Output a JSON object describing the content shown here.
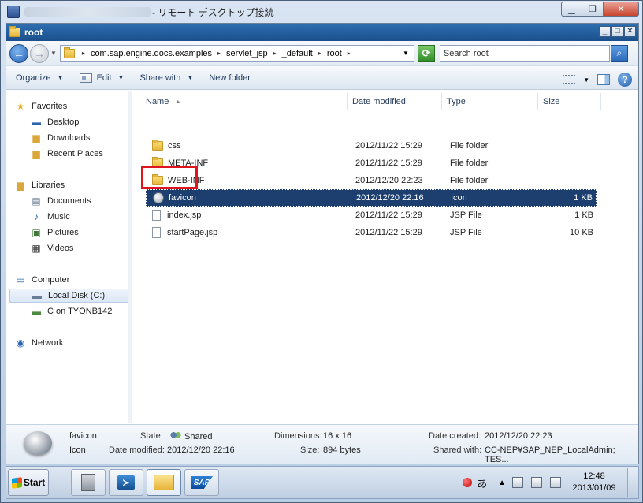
{
  "rdp": {
    "title": "- リモート デスクトップ接続"
  },
  "explorer": {
    "title": "root",
    "address": {
      "crumbs": [
        "com.sap.engine.docs.examples",
        "servlet_jsp",
        "_default",
        "root"
      ]
    },
    "search_placeholder": "Search root",
    "toolbar": {
      "organize": "Organize",
      "edit": "Edit",
      "share_with": "Share with",
      "new_folder": "New folder"
    },
    "nav": {
      "favorites": "Favorites",
      "desktop": "Desktop",
      "downloads": "Downloads",
      "recent": "Recent Places",
      "libraries": "Libraries",
      "documents": "Documents",
      "music": "Music",
      "pictures": "Pictures",
      "videos": "Videos",
      "computer": "Computer",
      "local_disk": "Local Disk (C:)",
      "c_on": "C on TYONB142",
      "network": "Network"
    },
    "columns": {
      "name": "Name",
      "date": "Date modified",
      "type": "Type",
      "size": "Size"
    },
    "files": [
      {
        "name": "css",
        "date": "2012/11/22 15:29",
        "type": "File folder",
        "size": ""
      },
      {
        "name": "META-INF",
        "date": "2012/11/22 15:29",
        "type": "File folder",
        "size": ""
      },
      {
        "name": "WEB-INF",
        "date": "2012/12/20 22:23",
        "type": "File folder",
        "size": ""
      },
      {
        "name": "favicon",
        "date": "2012/12/20 22:16",
        "type": "Icon",
        "size": "1 KB"
      },
      {
        "name": "index.jsp",
        "date": "2012/11/22 15:29",
        "type": "JSP File",
        "size": "1 KB"
      },
      {
        "name": "startPage.jsp",
        "date": "2012/11/22 15:29",
        "type": "JSP File",
        "size": "10 KB"
      }
    ],
    "details": {
      "name": "favicon",
      "kind": "Icon",
      "state_label": "State:",
      "state_value": "Shared",
      "modified_label": "Date modified:",
      "modified_value": "2012/12/20 22:16",
      "dimensions_label": "Dimensions:",
      "dimensions_value": "16 x 16",
      "size_label": "Size:",
      "size_value": "894 bytes",
      "created_label": "Date created:",
      "created_value": "2012/12/20 22:23",
      "shared_label": "Shared with:",
      "shared_value": "CC-NEP¥SAP_NEP_LocalAdmin; TES..."
    }
  },
  "taskbar": {
    "start": "Start",
    "ime": "あ",
    "time": "12:48",
    "date": "2013/01/09"
  },
  "colors": {
    "selection": "#1c3f70",
    "highlight_box": "#e0141e"
  }
}
